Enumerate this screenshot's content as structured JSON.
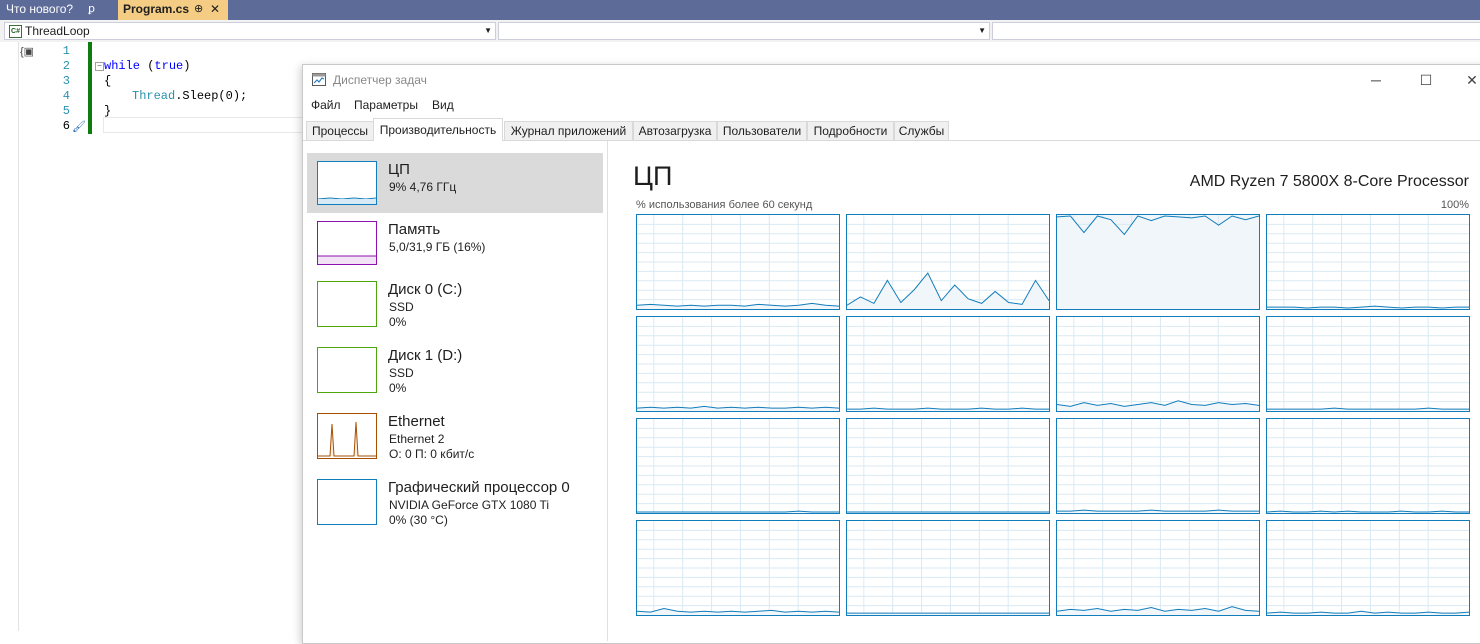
{
  "vs": {
    "tabs": {
      "whats_new": "Что нового?",
      "whats_new_pin": "ꝑ",
      "program": "Program.cs",
      "program_pin": "⊕",
      "program_close": "✕"
    },
    "navbar": {
      "class_combo": "ThreadLoop",
      "cs_badge": "C#"
    },
    "editor": {
      "line_numbers": [
        "1",
        "2",
        "3",
        "4",
        "5",
        "6"
      ],
      "code": {
        "line2_kw1": "while",
        "line2_rest_open": " (",
        "line2_kw2": "true",
        "line2_rest_close": ")",
        "line3": "{",
        "line4_type": "Thread",
        "line4_rest": ".Sleep(0);",
        "line5": "}"
      }
    }
  },
  "task_manager": {
    "title": "Диспетчер задач",
    "menu": [
      "Файл",
      "Параметры",
      "Вид"
    ],
    "tabs": [
      "Процессы",
      "Производительность",
      "Журнал приложений",
      "Автозагрузка",
      "Пользователи",
      "Подробности",
      "Службы"
    ],
    "active_tab": "Производительность",
    "sidebar": [
      {
        "name": "ЦП",
        "line1": "9%  4,76 ГГц",
        "line2": "",
        "color": "#117dbb",
        "selected": true
      },
      {
        "name": "Память",
        "line1": "5,0/31,9 ГБ (16%)",
        "line2": "",
        "color": "#8b12ae",
        "selected": false
      },
      {
        "name": "Диск 0 (C:)",
        "line1": "SSD",
        "line2": "0%",
        "color": "#4da60c",
        "selected": false
      },
      {
        "name": "Диск 1 (D:)",
        "line1": "SSD",
        "line2": "0%",
        "color": "#4da60c",
        "selected": false
      },
      {
        "name": "Ethernet",
        "line1": "Ethernet 2",
        "line2": "О: 0  П: 0 кбит/с",
        "color": "#a74f01",
        "selected": false
      },
      {
        "name": "Графический процессор 0",
        "line1": "NVIDIA GeForce GTX 1080 Ti",
        "line2": "0%  (30 °C)",
        "color": "#117dbb",
        "selected": false
      }
    ],
    "cpu": {
      "heading": "ЦП",
      "model": "AMD Ryzen 7 5800X 8-Core Processor",
      "usage_label": "% использования более 60 секунд",
      "max_label": "100%",
      "graph_color": "#117dbb",
      "graph_fill": "#f1f6fa"
    }
  },
  "chart_data": {
    "type": "line",
    "title": "% использования более 60 секунд",
    "ylim": [
      0,
      100
    ],
    "x": [
      0,
      4,
      8,
      12,
      16,
      20,
      24,
      28,
      32,
      36,
      40,
      44,
      48,
      52,
      56,
      60
    ],
    "series": [
      {
        "values": [
          3,
          4,
          3,
          2,
          3,
          2,
          3,
          3,
          2,
          4,
          3,
          2,
          3,
          5,
          3,
          2
        ]
      },
      {
        "values": [
          3,
          12,
          5,
          30,
          6,
          20,
          38,
          8,
          25,
          10,
          5,
          18,
          6,
          4,
          30,
          8
        ]
      },
      {
        "values": [
          99,
          100,
          82,
          100,
          96,
          80,
          100,
          95,
          100,
          99,
          98,
          100,
          90,
          100,
          96,
          100
        ]
      },
      {
        "values": [
          1,
          1,
          1,
          0,
          1,
          1,
          0,
          1,
          2,
          1,
          0,
          1,
          1,
          0,
          1,
          1
        ]
      },
      {
        "values": [
          2,
          3,
          2,
          3,
          2,
          4,
          2,
          3,
          2,
          3,
          2,
          2,
          3,
          2,
          3,
          2
        ]
      },
      {
        "values": [
          1,
          1,
          2,
          1,
          1,
          1,
          2,
          1,
          1,
          1,
          2,
          1,
          1,
          2,
          1,
          1
        ]
      },
      {
        "values": [
          6,
          4,
          8,
          5,
          7,
          4,
          6,
          8,
          5,
          10,
          6,
          5,
          8,
          6,
          7,
          5
        ]
      },
      {
        "values": [
          1,
          1,
          1,
          1,
          1,
          2,
          1,
          1,
          1,
          1,
          1,
          1,
          2,
          1,
          1,
          1
        ]
      },
      {
        "values": [
          0,
          0,
          0,
          0,
          0,
          0,
          0,
          0,
          0,
          0,
          0,
          0,
          1,
          0,
          0,
          0
        ]
      },
      {
        "values": [
          0,
          0,
          0,
          0,
          0,
          0,
          0,
          0,
          0,
          0,
          0,
          0,
          0,
          0,
          0,
          0
        ]
      },
      {
        "values": [
          1,
          1,
          2,
          1,
          1,
          1,
          1,
          2,
          1,
          1,
          1,
          1,
          2,
          1,
          1,
          1
        ]
      },
      {
        "values": [
          0,
          1,
          0,
          0,
          1,
          0,
          1,
          0,
          0,
          0,
          1,
          0,
          0,
          1,
          0,
          0
        ]
      },
      {
        "values": [
          3,
          2,
          6,
          3,
          2,
          3,
          2,
          3,
          2,
          3,
          4,
          2,
          3,
          2,
          3,
          2
        ]
      },
      {
        "values": [
          1,
          1,
          1,
          1,
          1,
          1,
          1,
          1,
          1,
          1,
          1,
          1,
          1,
          1,
          1,
          1
        ]
      },
      {
        "values": [
          3,
          5,
          4,
          6,
          3,
          5,
          4,
          7,
          3,
          5,
          4,
          6,
          3,
          8,
          4,
          3
        ]
      },
      {
        "values": [
          1,
          2,
          1,
          1,
          2,
          1,
          1,
          3,
          1,
          2,
          1,
          1,
          2,
          1,
          1,
          2
        ]
      }
    ]
  }
}
